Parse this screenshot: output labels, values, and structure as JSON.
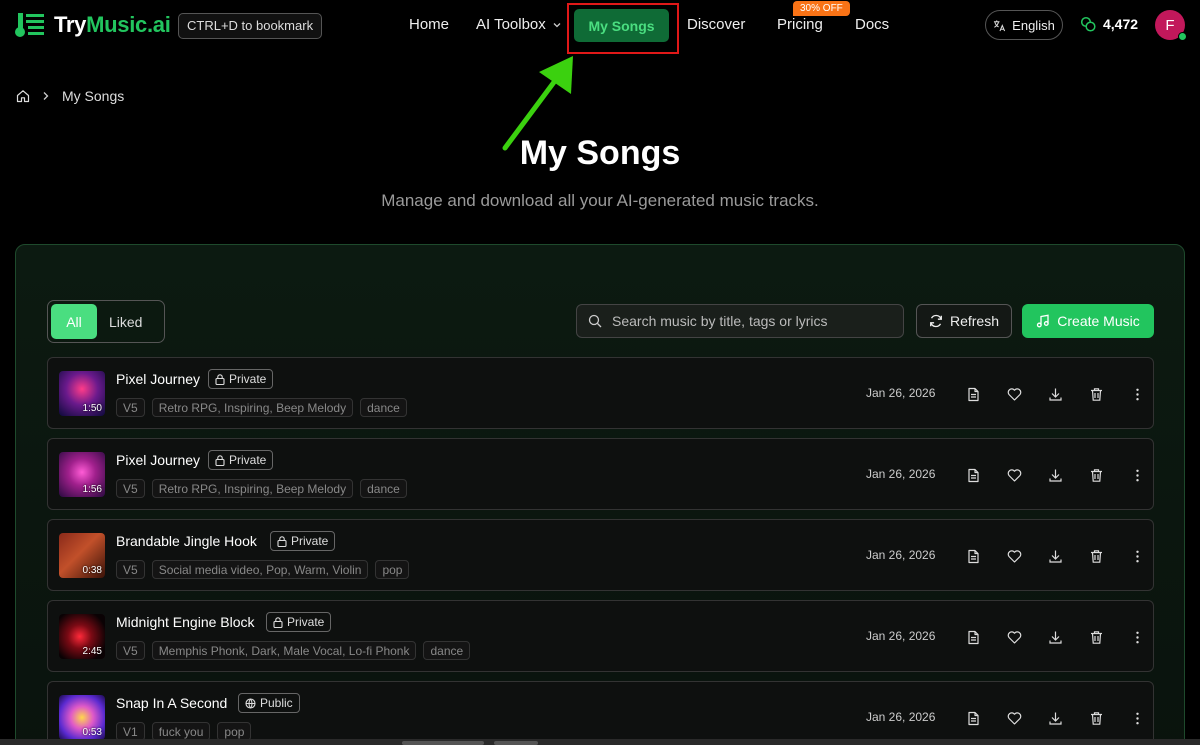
{
  "nav": {
    "logo_part1": "Try",
    "logo_part2": "Music.ai",
    "bookmark_hint": "CTRL+D to bookmark",
    "home": "Home",
    "toolbox": "AI Toolbox",
    "my_songs": "My Songs",
    "discover": "Discover",
    "pricing": "Pricing",
    "pricing_badge": "30% OFF",
    "docs": "Docs",
    "language": "English",
    "credits": "4,472",
    "avatar_initial": "F"
  },
  "breadcrumb": {
    "current": "My Songs"
  },
  "page": {
    "title": "My Songs",
    "subtitle": "Manage and download all your AI-generated music tracks."
  },
  "toolbar": {
    "filter_all": "All",
    "filter_liked": "Liked",
    "search_placeholder": "Search music by title, tags or lyrics",
    "refresh_label": "Refresh",
    "create_label": "Create Music"
  },
  "songs": [
    {
      "title": "Pixel Journey",
      "visibility": "Private",
      "duration": "1:50",
      "version": "V5",
      "tags": "Retro RPG, Inspiring, Beep Melody",
      "genre": "dance",
      "date": "Jan 26, 2026"
    },
    {
      "title": "Pixel Journey",
      "visibility": "Private",
      "duration": "1:56",
      "version": "V5",
      "tags": "Retro RPG, Inspiring, Beep Melody",
      "genre": "dance",
      "date": "Jan 26, 2026"
    },
    {
      "title": "Brandable Jingle Hook",
      "visibility": "Private",
      "duration": "0:38",
      "version": "V5",
      "tags": "Social media video, Pop, Warm, Violin",
      "genre": "pop",
      "date": "Jan 26, 2026"
    },
    {
      "title": "Midnight Engine Block",
      "visibility": "Private",
      "duration": "2:45",
      "version": "V5",
      "tags": "Memphis Phonk, Dark, Male Vocal, Lo-fi Phonk",
      "genre": "dance",
      "date": "Jan 26, 2026"
    },
    {
      "title": "Snap In A Second",
      "visibility": "Public",
      "duration": "0:53",
      "version": "V1",
      "tags": "fuck you",
      "genre": "pop",
      "date": "Jan 26, 2026"
    }
  ]
}
